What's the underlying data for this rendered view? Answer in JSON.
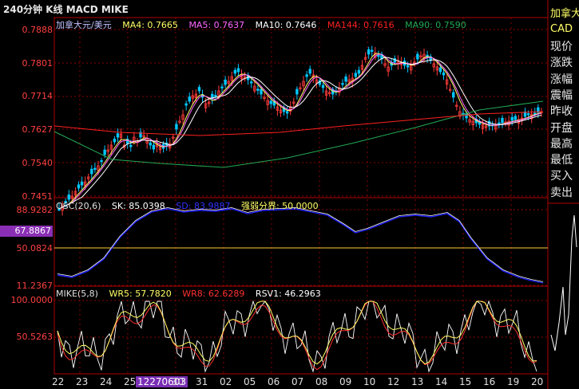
{
  "header": {
    "title": "240分钟 K线 MACD MIKE"
  },
  "main_panel": {
    "yticks": [
      "0.7888",
      "0.7801",
      "0.7714",
      "0.7627",
      "0.7540",
      "0.7451"
    ],
    "legend": {
      "symbol": "加拿大元/美元",
      "ma4": "MA4: 0.7665",
      "ma5": "MA5: 0.7637",
      "ma10": "MA10: 0.7646",
      "ma144": "MA144: 0.7616",
      "ma90": "MA90: 0.7590"
    }
  },
  "osc_panel": {
    "yticks": [
      "88.9282",
      "50.0824",
      "11.2367"
    ],
    "highlight": "67.8867",
    "legend": {
      "name": "OSC(20,6)",
      "sk": "SK: 85.0398",
      "sd": "SD: 83.9887",
      "strength": "强弱分界: 50.0000"
    }
  },
  "mike_panel": {
    "yticks": [
      "100.0000",
      "50.5263"
    ],
    "legend": {
      "name": "MIKE(5,8)",
      "wr5": "WR5: 57.7820",
      "wr8": "WR8: 62.6289",
      "rsv1": "RSV1: 46.2963"
    }
  },
  "xaxis": {
    "labels": [
      "22",
      "23",
      "24",
      "25",
      "12270603",
      "30",
      "31",
      "02",
      "05",
      "06",
      "07",
      "08",
      "09",
      "10",
      "12",
      "13",
      "14",
      "15",
      "16",
      "19",
      "20"
    ],
    "selected": "12270603"
  },
  "side_panel": {
    "title": "加拿大",
    "code": "CAD",
    "items": [
      "现价",
      "涨跌",
      "涨幅",
      "震幅",
      "昨收",
      "开盘",
      "最高",
      "最低",
      "买入",
      "卖出"
    ]
  },
  "colors": {
    "up": "#ff3b3b",
    "down": "#00c8ff",
    "ma4": "#ffff66",
    "ma5": "#ff66ff",
    "ma10": "#ffffff",
    "ma144": "#ff2020",
    "ma90": "#22aa55",
    "grid": "#8b0000",
    "sk": "#ffffff",
    "sd": "#2020ff"
  }
}
